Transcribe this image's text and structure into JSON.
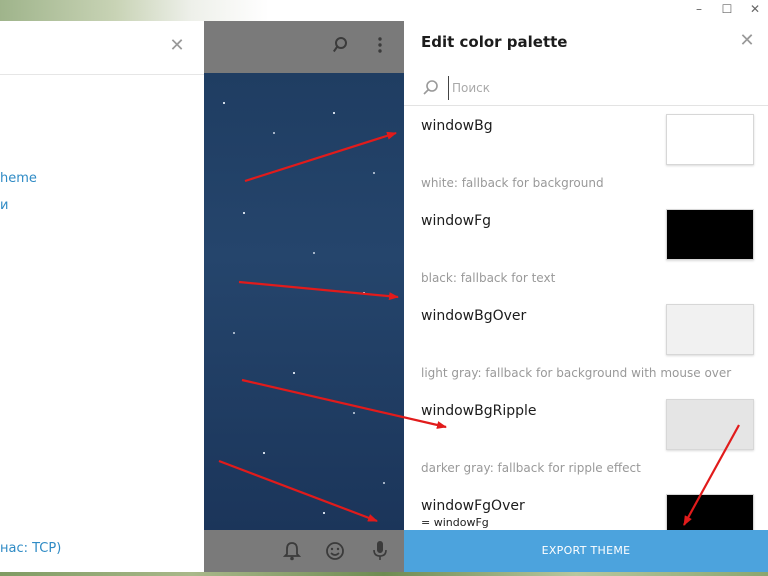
{
  "window": {
    "minimize": "–",
    "maximize": "☐",
    "close": "✕"
  },
  "left_panel": {
    "close_icon": "close-icon",
    "links": [
      "heme",
      "и"
    ],
    "status": "нас: TCP)"
  },
  "palette": {
    "title": "Edit color palette",
    "search_placeholder": "Поиск",
    "items": [
      {
        "name": "windowBg",
        "sub": "",
        "desc": "white: fallback for background",
        "color": "#ffffff"
      },
      {
        "name": "windowFg",
        "sub": "",
        "desc": "black: fallback for text",
        "color": "#000000"
      },
      {
        "name": "windowBgOver",
        "sub": "",
        "desc": "light gray: fallback for background with mouse over",
        "color": "#f1f1f1"
      },
      {
        "name": "windowBgRipple",
        "sub": "",
        "desc": "darker gray: fallback for ripple effect",
        "color": "#e5e5e5"
      },
      {
        "name": "windowFgOver",
        "sub": "= windowFg",
        "desc": "",
        "color": "#000000"
      }
    ],
    "export_label": "EXPORT THEME"
  },
  "colors": {
    "accent": "#4ca3dd",
    "arrow": "#e11b1b",
    "chat_header": "#7a7a7a",
    "chat_bg": "#1f3d62"
  }
}
